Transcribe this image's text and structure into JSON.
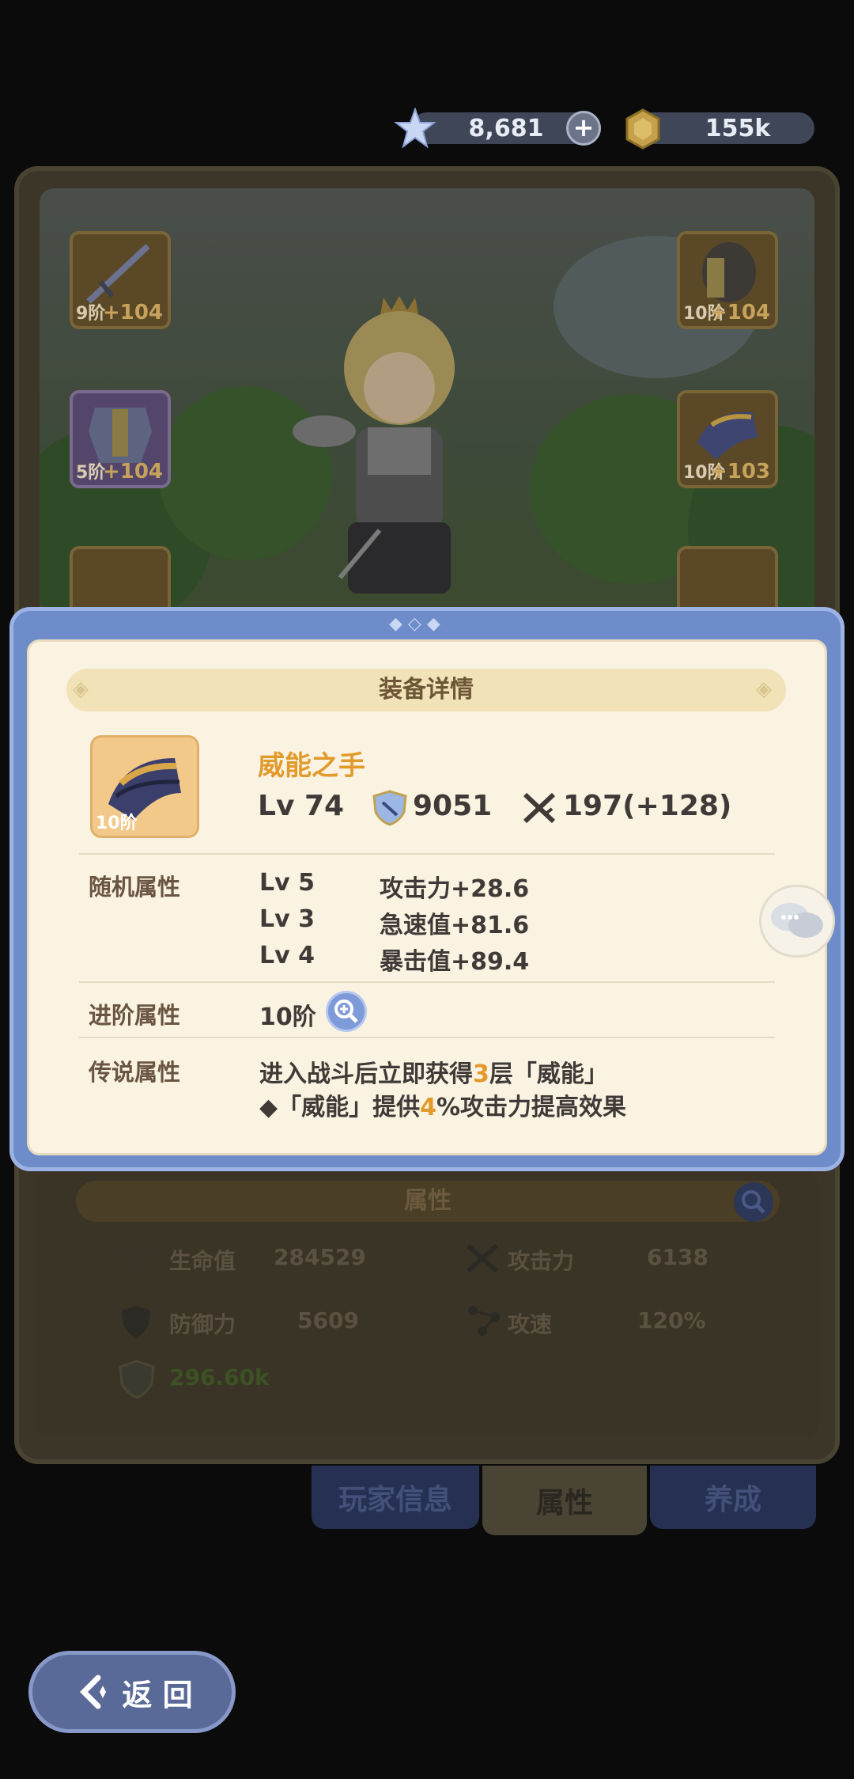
{
  "currency": {
    "gems": "8,681",
    "coins": "155k"
  },
  "equipment_slots": {
    "left": [
      {
        "tier": "9阶",
        "plus": "+104"
      },
      {
        "tier": "5阶",
        "plus": "+104"
      }
    ],
    "right": [
      {
        "tier": "10阶",
        "plus": "+104"
      },
      {
        "tier": "10阶",
        "plus": "+103"
      }
    ]
  },
  "popup": {
    "title": "装备详情",
    "item_name": "威能之手",
    "item_tier": "10阶",
    "level": "Lv 74",
    "power": "9051",
    "attack": "197(+128)",
    "random_label": "随机属性",
    "random_attrs": [
      {
        "level": "Lv 5",
        "value": "攻击力+28.6"
      },
      {
        "level": "Lv 3",
        "value": "急速值+81.6"
      },
      {
        "level": "Lv 4",
        "value": "暴击值+89.4"
      }
    ],
    "advance_label": "进阶属性",
    "advance_value": "10阶",
    "legend_label": "传说属性",
    "legend_line1_a": "进入战斗后立即获得",
    "legend_line1_num": "3",
    "legend_line1_b": "层「威能」",
    "legend_line2_a": "◆「威能」提供",
    "legend_line2_num": "4",
    "legend_line2_b": "%攻击力提高效果"
  },
  "attributes": {
    "title": "属性",
    "hp_label": "生命值",
    "hp_value": "284529",
    "atk_label": "攻击力",
    "atk_value": "6138",
    "def_label": "防御力",
    "def_value": "5609",
    "spd_label": "攻速",
    "spd_value": "120%",
    "power_value": "296.60k"
  },
  "tabs": {
    "player_info": "玩家信息",
    "attributes": "属性",
    "training": "养成"
  },
  "back_button": "返 回",
  "colors": {
    "popup_frame": "#6e8cc9",
    "popup_bg": "#faf3e2",
    "highlight": "#e39a2c"
  }
}
